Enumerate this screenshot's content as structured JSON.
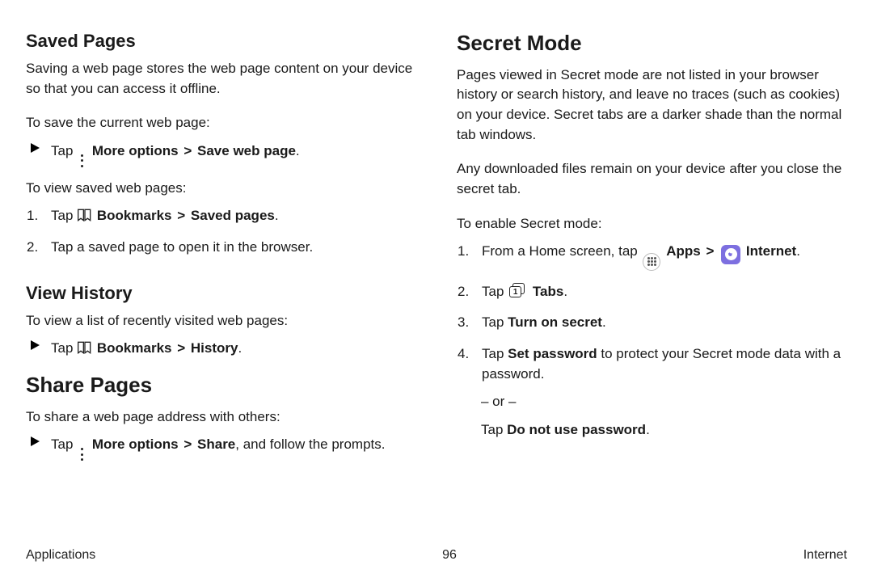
{
  "left": {
    "saved_pages": {
      "heading": "Saved Pages",
      "desc": "Saving a web page stores the web page content on your device so that you can access it offline.",
      "to_save_lead": "To save the current web page:",
      "save_step": {
        "prefix": "Tap",
        "more_options": "More options",
        "sep": ">",
        "save_web_page": "Save web page",
        "suffix": "."
      },
      "to_view_lead": "To view saved web pages:",
      "view_step1": {
        "num": "1.",
        "prefix": "Tap",
        "bookmarks": "Bookmarks",
        "sep": ">",
        "saved_pages": "Saved pages",
        "suffix": "."
      },
      "view_step2": {
        "num": "2.",
        "text": "Tap a saved page to open it in the browser."
      }
    },
    "view_history": {
      "heading": "View History",
      "lead": "To view a list of recently visited web pages:",
      "step": {
        "prefix": "Tap",
        "bookmarks": "Bookmarks",
        "sep": ">",
        "history": "History",
        "suffix": "."
      }
    },
    "share_pages": {
      "heading": "Share Pages",
      "lead": "To share a web page address with others:",
      "step": {
        "prefix": "Tap",
        "more_options": "More options",
        "sep": ">",
        "share": "Share",
        "suffix": ", and follow the prompts."
      }
    }
  },
  "right": {
    "secret_mode": {
      "heading": "Secret Mode",
      "p1": "Pages viewed in Secret mode are not listed in your browser history or search history, and leave no traces (such as cookies) on your device. Secret tabs are a darker shade than the normal tab windows.",
      "p2": "Any downloaded files remain on your device after you close the secret tab.",
      "enable_lead": "To enable Secret mode:",
      "step1": {
        "num": "1.",
        "prefix": "From a Home screen, tap",
        "apps": "Apps",
        "sep": ">",
        "internet": "Internet",
        "suffix": "."
      },
      "step2": {
        "num": "2.",
        "prefix": "Tap",
        "tabs_number": "1",
        "tabs": "Tabs",
        "suffix": "."
      },
      "step3": {
        "num": "3.",
        "prefix": "Tap ",
        "turn_on": "Turn on secret",
        "suffix": "."
      },
      "step4": {
        "num": "4.",
        "prefix": "Tap ",
        "set_password": "Set password",
        "rest": " to protect your Secret mode data with a password."
      },
      "or": "– or –",
      "alt": {
        "prefix": "Tap ",
        "dnup": "Do not use password",
        "suffix": "."
      }
    }
  },
  "footer": {
    "left": "Applications",
    "center": "96",
    "right": "Internet"
  }
}
